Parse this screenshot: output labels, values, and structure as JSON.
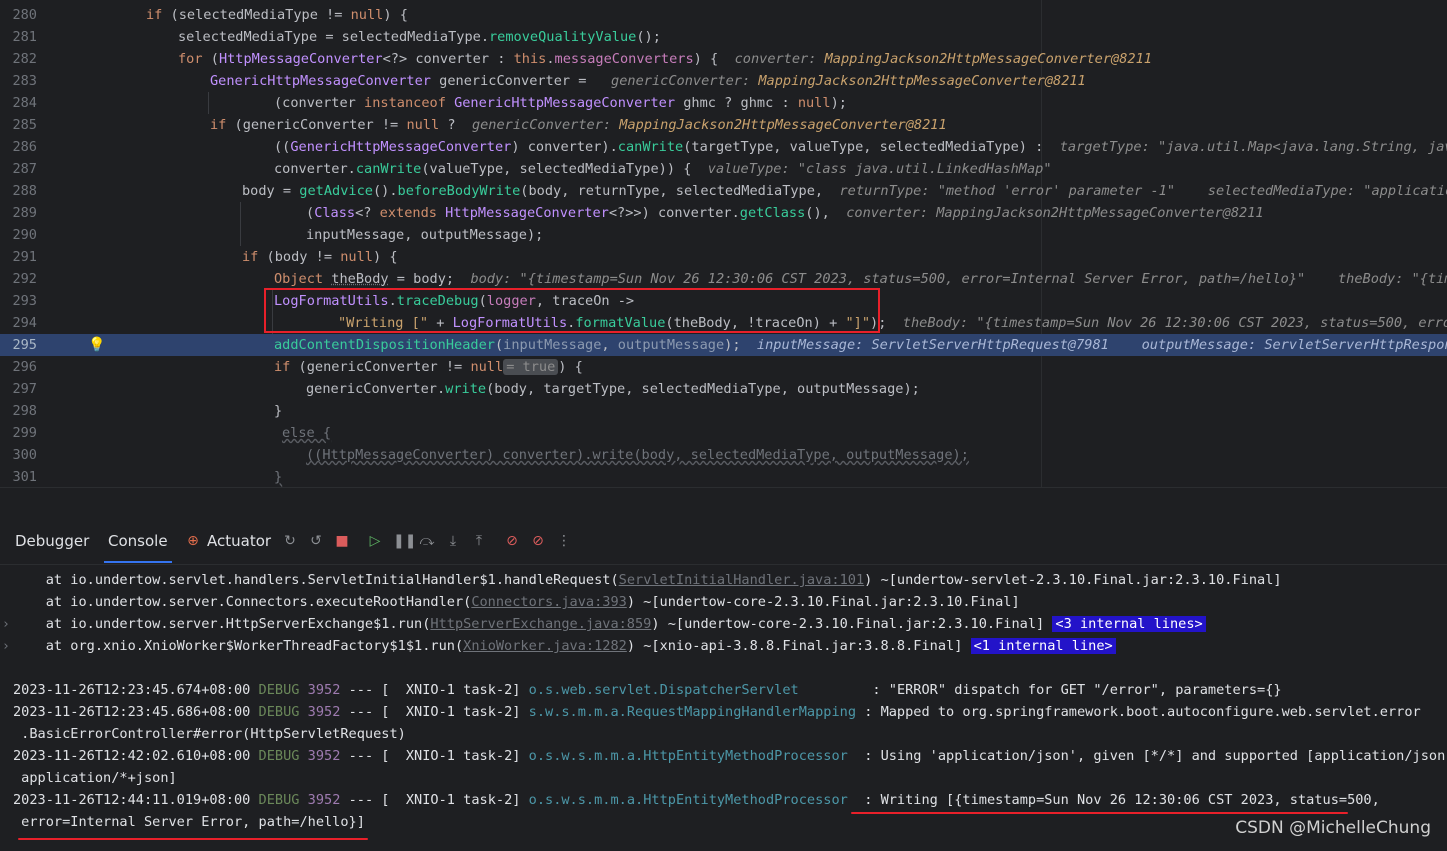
{
  "editor": {
    "lines": [
      {
        "num": "280"
      },
      {
        "num": "281"
      },
      {
        "num": "282"
      },
      {
        "num": "283"
      },
      {
        "num": "284"
      },
      {
        "num": "285"
      },
      {
        "num": "286"
      },
      {
        "num": "287"
      },
      {
        "num": "288"
      },
      {
        "num": "289"
      },
      {
        "num": "290"
      },
      {
        "num": "291"
      },
      {
        "num": "292"
      },
      {
        "num": "293"
      },
      {
        "num": "294"
      },
      {
        "num": "295"
      },
      {
        "num": "296"
      },
      {
        "num": "297"
      },
      {
        "num": "298"
      },
      {
        "num": "299"
      },
      {
        "num": "300"
      },
      {
        "num": "301"
      }
    ]
  },
  "toolwindow": {
    "tabs": {
      "debugger": "Debugger",
      "console": "Console",
      "actuator": "Actuator"
    }
  },
  "console": {
    "lines": [
      "    at io.undertow.servlet.handlers.ServletInitialHandler$1.handleRequest(",
      "ServletInitialHandler.java:101",
      ") ~[undertow-servlet-2.3.10.Final.jar:2.3.10.Final]",
      "    at io.undertow.server.Connectors.executeRootHandler(",
      "Connectors.java:393",
      ") ~[undertow-core-2.3.10.Final.jar:2.3.10.Final]",
      "    at io.undertow.server.HttpServerExchange$1.run(",
      "HttpServerExchange.java:859",
      ") ~[undertow-core-2.3.10.Final.jar:2.3.10.Final] ",
      "<3 internal lines>",
      "    at org.xnio.XnioWorker$WorkerThreadFactory$1$1.run(",
      "XnioWorker.java:1282",
      ") ~[xnio-api-3.8.8.Final.jar:3.8.8.Final] ",
      "<1 internal line>"
    ],
    "logs": [
      {
        "ts": "2023-11-26T12:23:45.674+08:00",
        "level": "DEBUG",
        "pid": "3952",
        "sep": " --- [  XNIO-1 task-2] ",
        "logger": "o.s.web.servlet.DispatcherServlet        ",
        "msg": " : \"ERROR\" dispatch for GET \"/error\", parameters={}"
      },
      {
        "ts": "2023-11-26T12:23:45.686+08:00",
        "level": "DEBUG",
        "pid": "3952",
        "sep": " --- [  XNIO-1 task-2] ",
        "logger": "s.w.s.m.m.a.RequestMappingHandlerMapping",
        "msg": " : Mapped to org.springframework.boot.autoconfigure.web.servlet.error",
        "cont": " .BasicErrorController#error(HttpServletRequest)"
      },
      {
        "ts": "2023-11-26T12:42:02.610+08:00",
        "level": "DEBUG",
        "pid": "3952",
        "sep": " --- [  XNIO-1 task-2] ",
        "logger": "o.s.w.s.m.m.a.HttpEntityMethodProcessor ",
        "msg": " : Using 'application/json', given [*/*] and supported [application/json,",
        "cont": " application/*+json]"
      },
      {
        "ts": "2023-11-26T12:44:11.019+08:00",
        "level": "DEBUG",
        "pid": "3952",
        "sep": " --- [  XNIO-1 task-2] ",
        "logger": "o.s.w.s.m.m.a.HttpEntityMethodProcessor ",
        "msg": " : Writing [{timestamp=Sun Nov 26 12:30:06 CST 2023, status=500,",
        "cont": " error=Internal Server Error, path=/hello}]"
      }
    ]
  },
  "watermark": "CSDN @MichelleChung"
}
